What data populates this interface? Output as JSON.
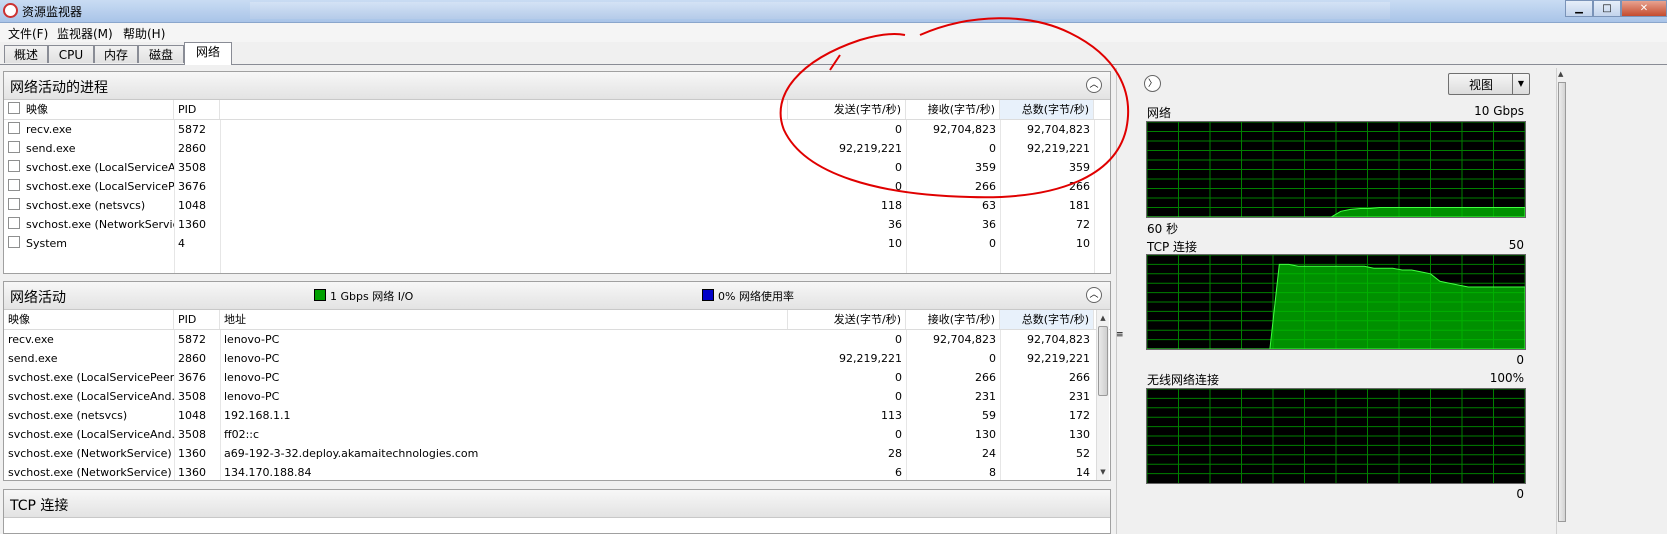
{
  "window": {
    "title": "资源监视器",
    "buttons": {
      "minimize": "▁",
      "maximize": "□",
      "close": "✕"
    }
  },
  "menu": [
    "文件(F)",
    "监视器(M)",
    "帮助(H)"
  ],
  "tabs": [
    "概述",
    "CPU",
    "内存",
    "磁盘",
    "网络"
  ],
  "active_tab": "网络",
  "processes_panel": {
    "title": "网络活动的进程",
    "columns": [
      "映像",
      "PID",
      "发送(字节/秒)",
      "接收(字节/秒)",
      "总数(字节/秒)"
    ],
    "rows": [
      [
        "recv.exe",
        "5872",
        "0",
        "92,704,823",
        "92,704,823"
      ],
      [
        "send.exe",
        "2860",
        "92,219,221",
        "0",
        "92,219,221"
      ],
      [
        "svchost.exe (LocalServiceA...",
        "3508",
        "0",
        "359",
        "359"
      ],
      [
        "svchost.exe (LocalServiceP...",
        "3676",
        "0",
        "266",
        "266"
      ],
      [
        "svchost.exe (netsvcs)",
        "1048",
        "118",
        "63",
        "181"
      ],
      [
        "svchost.exe (NetworkService)",
        "1360",
        "36",
        "36",
        "72"
      ],
      [
        "System",
        "4",
        "10",
        "0",
        "10"
      ]
    ]
  },
  "activity_panel": {
    "title": "网络活动",
    "legend_io": "1 Gbps 网络 I/O",
    "legend_io_color": "#00a000",
    "legend_usage": "0% 网络使用率",
    "legend_usage_color": "#0000c8",
    "columns": [
      "映像",
      "PID",
      "地址",
      "发送(字节/秒)",
      "接收(字节/秒)",
      "总数(字节/秒)"
    ],
    "rows": [
      [
        "recv.exe",
        "5872",
        "lenovo-PC",
        "0",
        "92,704,823",
        "92,704,823"
      ],
      [
        "send.exe",
        "2860",
        "lenovo-PC",
        "92,219,221",
        "0",
        "92,219,221"
      ],
      [
        "svchost.exe (LocalServicePeer...",
        "3676",
        "lenovo-PC",
        "0",
        "266",
        "266"
      ],
      [
        "svchost.exe (LocalServiceAnd...",
        "3508",
        "lenovo-PC",
        "0",
        "231",
        "231"
      ],
      [
        "svchost.exe (netsvcs)",
        "1048",
        "192.168.1.1",
        "113",
        "59",
        "172"
      ],
      [
        "svchost.exe (LocalServiceAnd...",
        "3508",
        "ff02::c",
        "0",
        "130",
        "130"
      ],
      [
        "svchost.exe (NetworkService)",
        "1360",
        "a69-192-3-32.deploy.akamaitechnologies.com",
        "28",
        "24",
        "52"
      ],
      [
        "svchost.exe (NetworkService)",
        "1360",
        "134.170.188.84",
        "6",
        "8",
        "14"
      ]
    ]
  },
  "tcp_panel": {
    "title": "TCP 连接"
  },
  "right_pane": {
    "view_label": "视图",
    "graphs": [
      {
        "title": "网络",
        "max": "10 Gbps",
        "bottom_left": "60 秒",
        "bottom_right": "",
        "trace": [
          0,
          0,
          0,
          0,
          0,
          0,
          0,
          0,
          0,
          0,
          0,
          0,
          0,
          0,
          0,
          0,
          0,
          0,
          0,
          0,
          6,
          8,
          9,
          9,
          10,
          10,
          10,
          10,
          10,
          10,
          10,
          10,
          10,
          10,
          10,
          10,
          10,
          10,
          10,
          10
        ],
        "scale": 100
      },
      {
        "title": "TCP 连接",
        "max": "50",
        "bottom_left": "",
        "bottom_right": "0",
        "trace": [
          0,
          0,
          0,
          0,
          0,
          0,
          0,
          0,
          0,
          0,
          0,
          0,
          0,
          0,
          45,
          45,
          44,
          44,
          44,
          44,
          44,
          44,
          44,
          44,
          43,
          43,
          43,
          42,
          42,
          41,
          40,
          36,
          35,
          34,
          33,
          33,
          33,
          33,
          33,
          33,
          33
        ],
        "scale": 50
      },
      {
        "title": "无线网络连接",
        "max": "100%",
        "bottom_left": "",
        "bottom_right": "0",
        "trace": [],
        "scale": 100
      }
    ],
    "graph_color": "#00c000"
  },
  "annotation": {
    "type": "hand-drawn circle",
    "color": "#e00000"
  }
}
